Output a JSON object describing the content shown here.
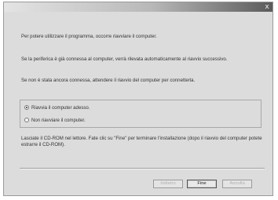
{
  "titlebar": {
    "close_glyph": "x"
  },
  "messages": {
    "line1": "Per potere utilizzare il programma, occorre riavviare il computer.",
    "line2": "Se la periferica è già connessa al computer, verrà rilevata automaticamente al riavvio successivo.",
    "line3": "Se non è stata ancora connessa, attendere il riavvio del computer per connetterla.",
    "line4": "Lasciate il CD-ROM nel lettore. Fate clic su \"Fine\" per terminare l'installazione (dopo il riavvio del computer potete estrarre il CD-ROM)."
  },
  "options": {
    "restart_now": {
      "label": "Riavvia il computer adesso.",
      "selected": true
    },
    "no_restart": {
      "label": "Non riavviare il computer.",
      "selected": false
    }
  },
  "buttons": {
    "back": "Indietro",
    "finish": "Fine",
    "cancel": "Annulla"
  }
}
